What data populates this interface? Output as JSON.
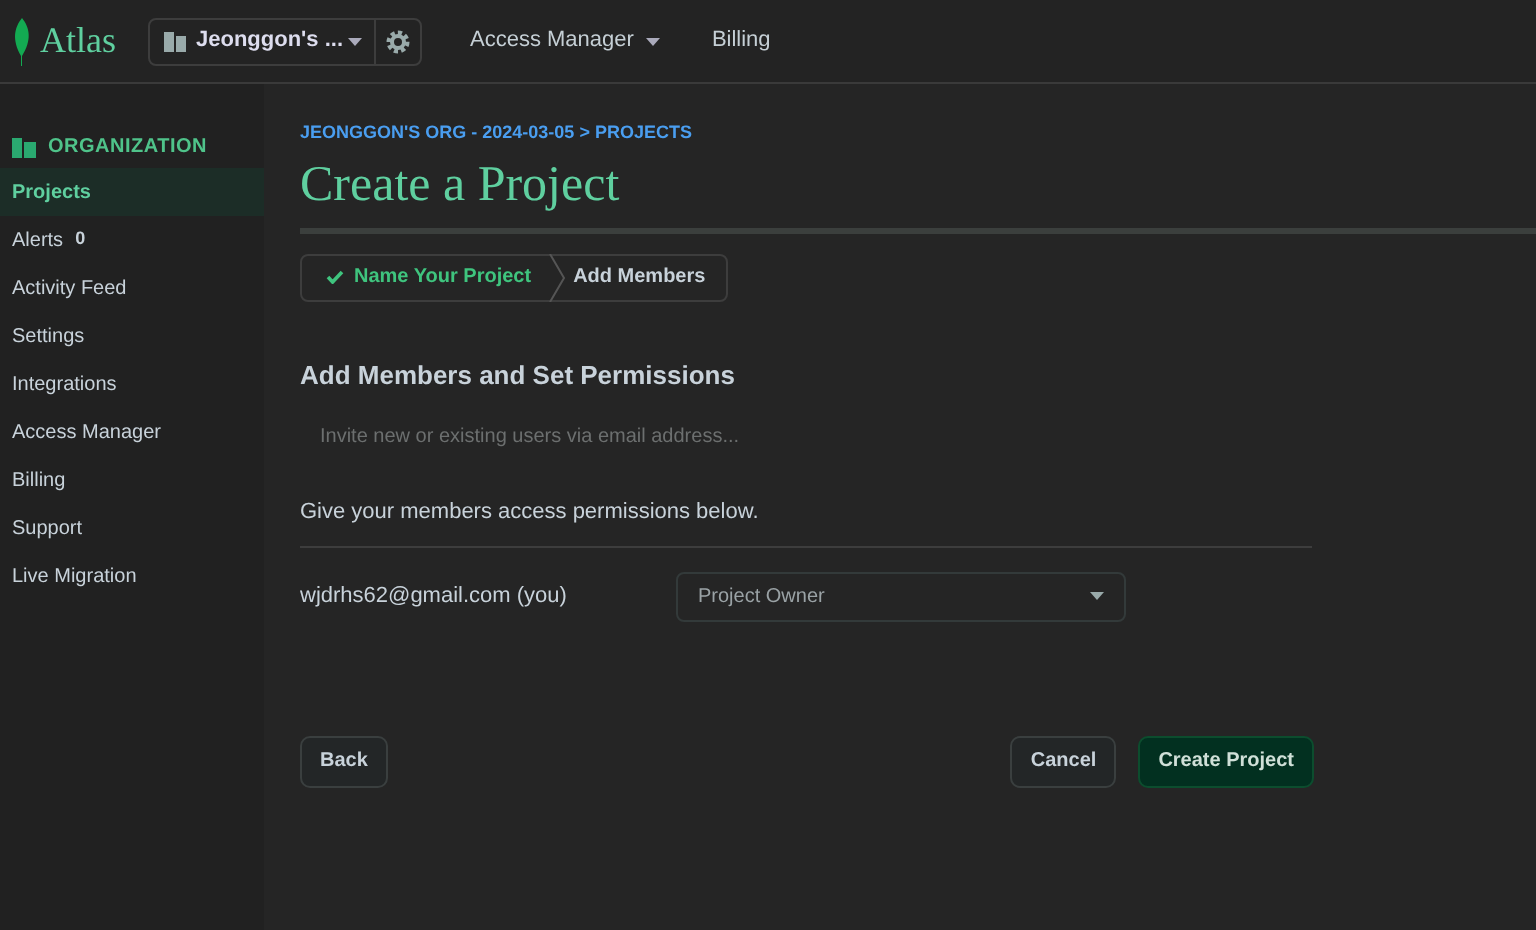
{
  "topbar": {
    "logo": "Atlas",
    "org": "Jeonggon's ...",
    "nav": [
      "Access Manager",
      "Billing"
    ]
  },
  "sidebar": {
    "heading": "ORGANIZATION",
    "items": [
      {
        "label": "Projects",
        "selected": true
      },
      {
        "label": "Alerts",
        "selected": false,
        "badge": "0"
      },
      {
        "label": "Activity Feed",
        "selected": false
      },
      {
        "label": "Settings",
        "selected": false
      },
      {
        "label": "Integrations",
        "selected": false
      },
      {
        "label": "Access Manager",
        "selected": false
      },
      {
        "label": "Billing",
        "selected": false
      },
      {
        "label": "Support",
        "selected": false
      },
      {
        "label": "Live Migration",
        "selected": false
      }
    ]
  },
  "breadcrumb": "JEONGGON'S ORG - 2024-03-05 > PROJECTS",
  "title": "Create a Project",
  "steps": [
    {
      "label": "Name Your Project",
      "completed": true
    },
    {
      "label": "Add Members",
      "completed": false
    }
  ],
  "section_title": "Add Members and Set Permissions",
  "invite": {
    "placeholder": "Invite new or existing users via email address..."
  },
  "permissions_hint": "Give your members access permissions below.",
  "members": [
    {
      "email": "wjdrhs62@gmail.com (you)",
      "role": "Project Owner"
    }
  ],
  "buttons": {
    "back": "Back",
    "cancel": "Cancel",
    "create": "Create Project"
  }
}
